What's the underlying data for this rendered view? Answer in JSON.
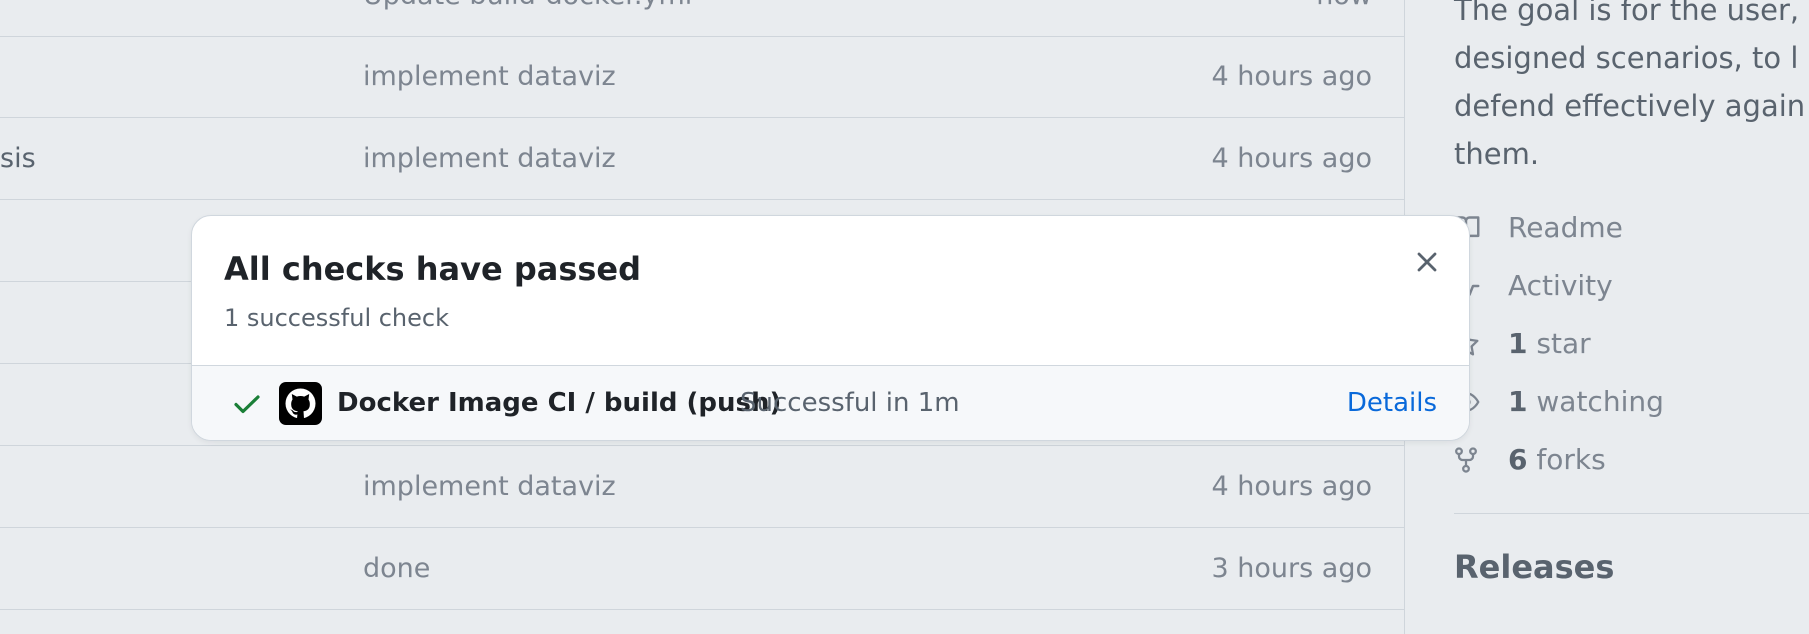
{
  "file_rows": [
    {
      "name": "",
      "message": "Update build-docker.yml",
      "time": "now"
    },
    {
      "name": "",
      "message": "implement dataviz",
      "time": "4 hours ago"
    },
    {
      "name": "sis",
      "message": "implement dataviz",
      "time": "4 hours ago"
    },
    {
      "name": "",
      "message": "",
      "time": ""
    },
    {
      "name": "",
      "message": "",
      "time": ""
    },
    {
      "name": "",
      "message": "",
      "time": ""
    },
    {
      "name": "",
      "message": "implement dataviz",
      "time": "4 hours ago"
    },
    {
      "name": "",
      "message": "done",
      "time": "3 hours ago"
    }
  ],
  "sidebar": {
    "about_lines": [
      "The goal is for the user,",
      "designed scenarios, to l",
      "defend effectively again",
      "them."
    ],
    "readme": "Readme",
    "activity": "Activity",
    "stars_count": "1",
    "stars_label": "star",
    "watching_count": "1",
    "watching_label": "watching",
    "forks_count": "6",
    "forks_label": "forks",
    "releases_heading": "Releases"
  },
  "checks_popover": {
    "title": "All checks have passed",
    "subtitle": "1 successful check",
    "check": {
      "name": "Docker Image CI / build (push)",
      "status": "Successful in 1m",
      "details_label": "Details"
    }
  }
}
